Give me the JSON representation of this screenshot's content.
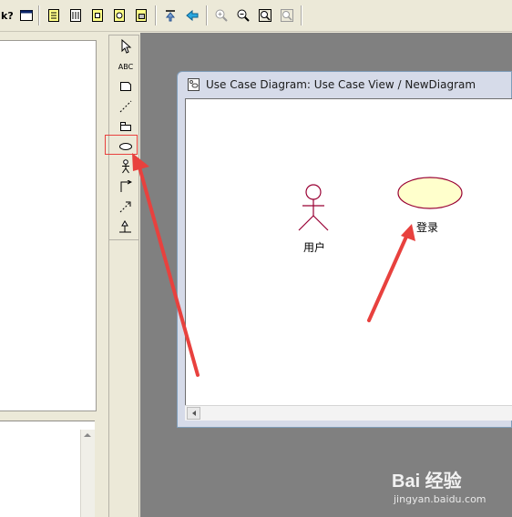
{
  "window": {
    "title": "Use Case Diagram: Use Case View / NewDiagram"
  },
  "toolbar": {
    "buttons": [
      "help-context-icon",
      "window-icon",
      "doc-icon",
      "ruler-icon",
      "class-diagram-icon",
      "component-icon",
      "deploy-icon",
      "browse-parent-icon",
      "browse-previous-icon",
      "zoom-in-icon",
      "zoom-out-icon",
      "fit-in-window-icon",
      "undo-fit-icon"
    ]
  },
  "toolbox": {
    "tools": [
      {
        "icon": "selection-arrow-icon"
      },
      {
        "icon": "text-box-icon",
        "label": "ABC"
      },
      {
        "icon": "note-icon"
      },
      {
        "icon": "anchor-line-icon"
      },
      {
        "icon": "package-icon"
      },
      {
        "icon": "use-case-icon",
        "selected": true
      },
      {
        "icon": "actor-icon"
      },
      {
        "icon": "unidirectional-association-icon"
      },
      {
        "icon": "dependency-icon"
      },
      {
        "icon": "generalization-icon"
      }
    ]
  },
  "diagram": {
    "actor": {
      "name": "用户"
    },
    "use_case": {
      "name": "登录"
    }
  },
  "colors": {
    "use_case_fill": "#ffffcc",
    "actor_stroke": "#990033",
    "annotation_arrow": "#e8413e",
    "selection_box": "#e8413e"
  },
  "watermark": {
    "logo": "Bai 经验",
    "url": "jingyan.baidu.com"
  }
}
